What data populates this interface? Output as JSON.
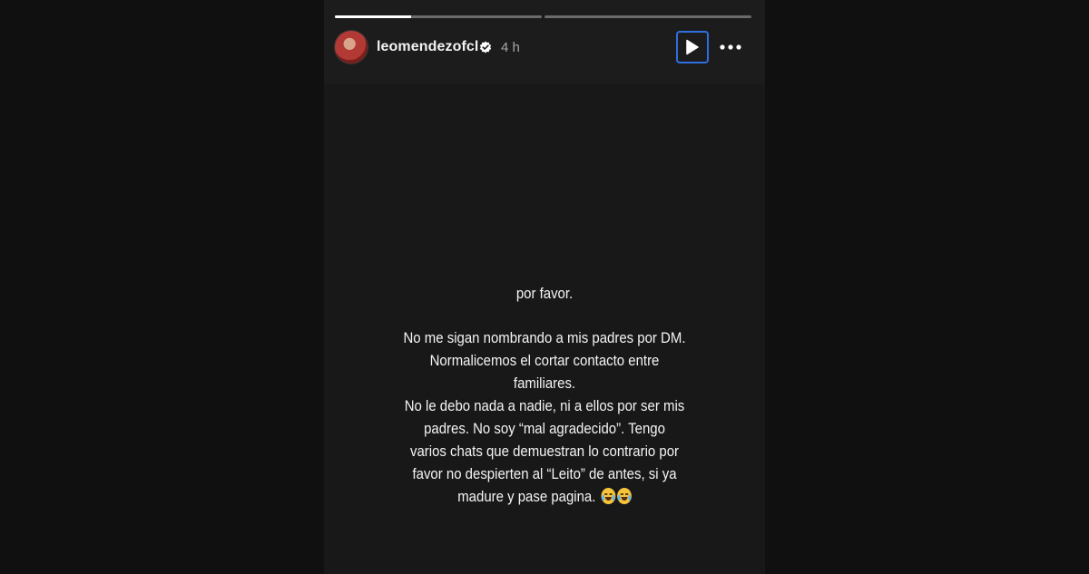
{
  "story": {
    "progress": [
      0.37,
      0.0
    ],
    "account": {
      "username": "leomendezofcl",
      "verified": true,
      "time_ago": "4 h"
    },
    "controls": {
      "play_icon": "play-icon",
      "more_icon": "more-icon"
    },
    "text": {
      "line1": "por favor.",
      "para2": [
        "No me sigan nombrando a mis padres por DM.",
        "Normalicemos el cortar contacto entre",
        "familiares.",
        "No le debo nada a nadie, ni a ellos por ser mis",
        "padres. No soy “mal agradecido”. Tengo",
        "varios chats que demuestran lo contrario por",
        "favor no despierten al “Leito” de antes, si ya",
        "madure y pase pagina."
      ],
      "emojis": [
        "loudly-crying-face-icon",
        "tears-of-joy-icon"
      ]
    }
  },
  "colors": {
    "background": "#101010",
    "story_bg": "#181818",
    "accent": "#2f6fe0",
    "text": "#f4f4f4"
  }
}
